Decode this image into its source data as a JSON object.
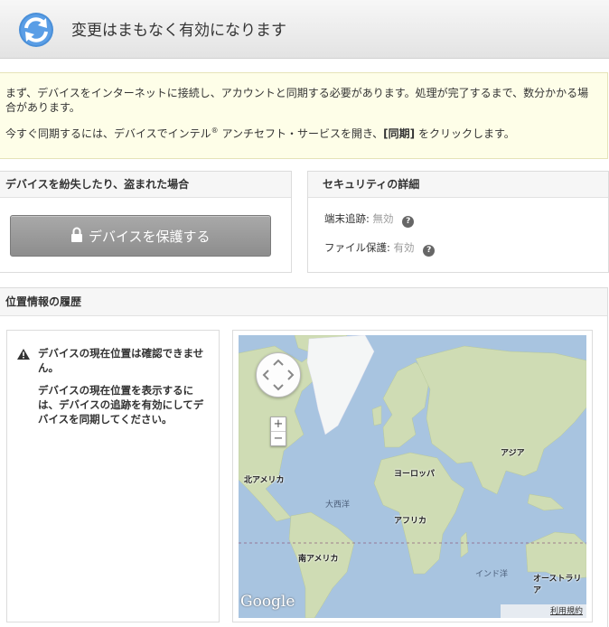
{
  "header": {
    "title": "変更はまもなく有効になります",
    "icon": "sync-icon"
  },
  "notice": {
    "line1": "まず、デバイスをインターネットに接続し、アカウントと同期する必要があります。処理が完了するまで、数分かかる場合があります。",
    "line2_before": "今すぐ同期するには、デバイスでインテル",
    "line2_reg": "®",
    "line2_middle": " アンチセフト・サービスを開き、",
    "line2_bold": "[同期]",
    "line2_after": " をクリックします。"
  },
  "lost_panel": {
    "title": "デバイスを紛失したり、盗まれた場合",
    "button": "デバイスを保護する"
  },
  "security_panel": {
    "title": "セキュリティの詳細",
    "rows": [
      {
        "label": "端末追跡:",
        "status": "無効"
      },
      {
        "label": "ファイル保護:",
        "status": "有効"
      }
    ],
    "help": "?"
  },
  "history_panel": {
    "title": "位置情報の履歴",
    "message_title": "デバイスの現在位置は確認できません。",
    "message_body": "デバイスの現在位置を表示するには、デバイスの追跡を有効にしてデバイスを同期してください。"
  },
  "map": {
    "labels": {
      "north_america": "北アメリカ",
      "south_america": "南アメリカ",
      "europe": "ヨーロッパ",
      "africa": "アフリカ",
      "asia": "アジア",
      "australia": "オーストラリア",
      "atlantic": "大西洋",
      "indian": "インド洋"
    },
    "zoom_in": "+",
    "zoom_out": "−",
    "logo": "Google",
    "terms": "利用規約"
  },
  "colors": {
    "ocean": "#a8c4e0",
    "land": "#cfdcb4",
    "warn": "#333333",
    "disabled_status": "#999999"
  }
}
